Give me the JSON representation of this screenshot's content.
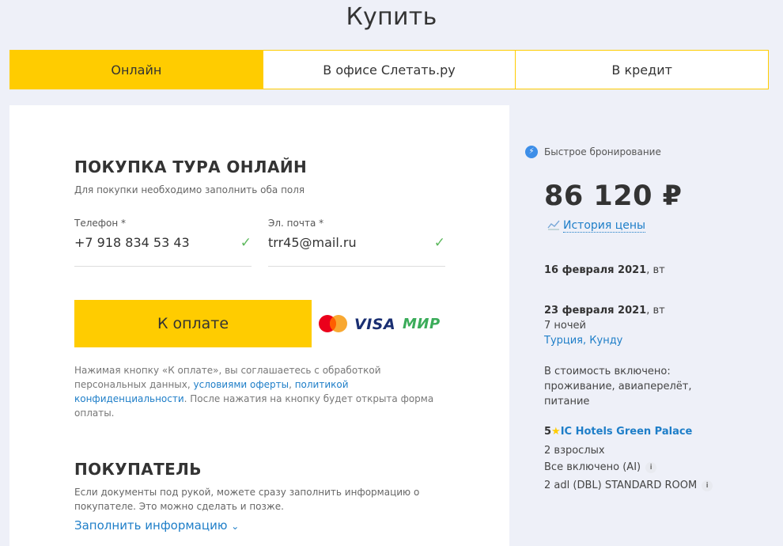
{
  "page": {
    "title": "Купить"
  },
  "tabs": [
    {
      "label": "Онлайн",
      "active": true
    },
    {
      "label": "В офисе Слетать.ру",
      "active": false
    },
    {
      "label": "В кредит",
      "active": false
    }
  ],
  "form": {
    "title": "ПОКУПКА ТУРА ОНЛАЙН",
    "hint": "Для покупки необходимо заполнить оба поля",
    "phone": {
      "label": "Телефон *",
      "value": "+7 918 834 53 43"
    },
    "email": {
      "label": "Эл. почта *",
      "value": "trr45@mail.ru"
    },
    "pay_button": "К оплате",
    "payment_logos": {
      "visa": "VISA",
      "mir": "МИР"
    },
    "agree": {
      "part1": "Нажимая кнопку «К оплате», вы соглашаетесь с обработкой персональных данных, ",
      "link1": "условиями оферты",
      "sep": ", ",
      "link2": "политикой конфиденциальности",
      "part2": ". После нажатия на кнопку будет открыта форма оплаты."
    }
  },
  "buyer": {
    "title": "ПОКУПАТЕЛЬ",
    "hint": "Если документы под рукой, можете сразу заполнить информацию о покупателе. Это можно сделать и позже.",
    "fill_link": "Заполнить информацию"
  },
  "summary": {
    "fast_booking": "Быстрое бронирование",
    "price": "86 120 ₽",
    "price_history": "История цены",
    "date_from": {
      "date": "16 февраля 2021",
      "day": ", вт"
    },
    "date_to": {
      "date": "23 февраля 2021",
      "day": ", вт"
    },
    "nights": "7 ночей",
    "destination": "Турция, Кунду",
    "included_label": "В стоимость включено:",
    "included_value": "проживание, авиаперелёт, питание",
    "hotel_stars": "5",
    "hotel_name": "IC Hotels Green Palace",
    "guests": "2 взрослых",
    "meal": "Все включено (AI)",
    "room": "2 adl (DBL) STANDARD ROOM"
  },
  "colors": {
    "accent": "#ffcc00",
    "link": "#1e7ec8",
    "check": "#5cb85c"
  }
}
